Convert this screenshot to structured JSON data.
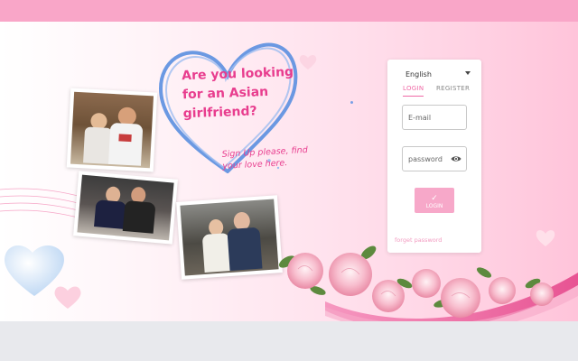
{
  "hero": {
    "headline": "Are you looking for an Asian girlfriend?",
    "subline": "Sign Up please, find your love here."
  },
  "login_card": {
    "language": "English",
    "tabs": [
      {
        "label": "LOGIN",
        "active": true
      },
      {
        "label": "REGISTER",
        "active": false
      }
    ],
    "email_placeholder": "E-mail",
    "password_placeholder": "password",
    "login_button": "LOGIN",
    "forgot_link": "forget password"
  },
  "icons": {
    "language_dropdown": "chevron-down-icon",
    "password_visibility": "eye-icon",
    "login_button": "check-icon"
  },
  "colors": {
    "accent": "#e83d8e",
    "tab_active": "#f06aa6",
    "button": "#f7a8c9",
    "heart_outline": "#5b8fe0",
    "top_bar": "#f9a6c8"
  }
}
